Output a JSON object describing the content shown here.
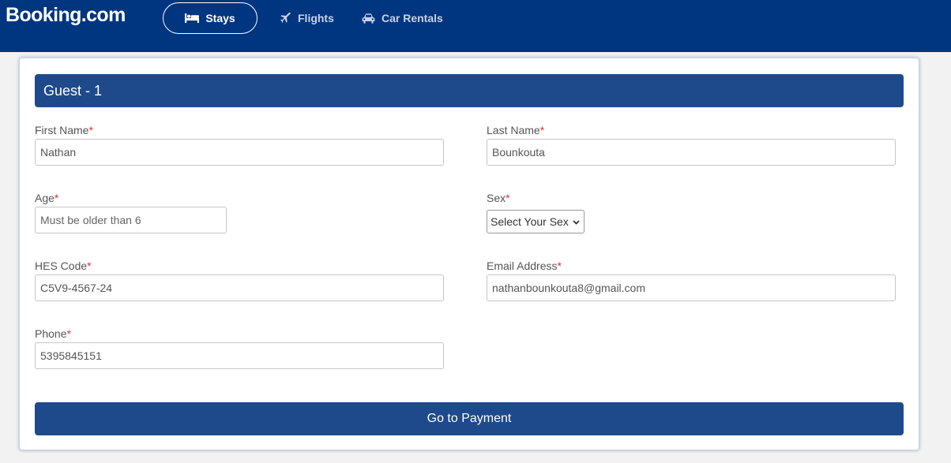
{
  "header": {
    "logo_text": "Booking.com",
    "background_color": "#003580",
    "nav": [
      {
        "label": "Stays",
        "icon": "bed-icon",
        "active": true
      },
      {
        "label": "Flights",
        "icon": "plane-icon",
        "active": false
      },
      {
        "label": "Car Rentals",
        "icon": "car-icon",
        "active": false
      }
    ]
  },
  "form": {
    "title": "Guest - 1",
    "required_marker": "*",
    "fields": {
      "first_name": {
        "label": "First Name",
        "value": "Nathan",
        "placeholder": ""
      },
      "last_name": {
        "label": "Last Name",
        "value": "Bounkouta",
        "placeholder": ""
      },
      "age": {
        "label": "Age",
        "value": "",
        "placeholder": "Must be older than 6"
      },
      "sex": {
        "label": "Sex",
        "selected": "Select Your Sex"
      },
      "hes_code": {
        "label": "HES Code",
        "value": "C5V9-4567-24",
        "placeholder": ""
      },
      "email": {
        "label": "Email Address",
        "value": "nathanbounkouta8@gmail.com",
        "placeholder": ""
      },
      "phone": {
        "label": "Phone",
        "value": "5395845151",
        "placeholder": ""
      }
    },
    "submit_label": "Go to Payment",
    "accent_color": "#1e4a8c"
  }
}
